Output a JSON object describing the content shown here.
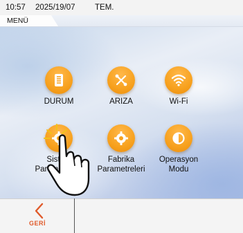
{
  "statusbar": {
    "time": "10:57",
    "date": "2025/19/07",
    "temperature": "TEM."
  },
  "menu_label": "MENÜ",
  "colors": {
    "icon_orange": "#f7a11e",
    "back_red": "#e05a2a"
  },
  "tiles": [
    {
      "label": "DURUM",
      "icon": "document-list-icon"
    },
    {
      "label": "ARIZA",
      "icon": "wrench-screwdriver-icon"
    },
    {
      "label": "Wi-Fi",
      "icon": "wifi-icon"
    },
    {
      "label_line1": "Sistem",
      "label_line2": "Parametreleri",
      "icon": "gear-icon"
    },
    {
      "label_line1": "Fabrika",
      "label_line2": "Parametreleri",
      "icon": "gear-icon"
    },
    {
      "label_line1": "Operasyon",
      "label_line2": "Modu",
      "icon": "half-circle-mode-icon"
    }
  ],
  "footer": {
    "back_label": "GERİ"
  }
}
